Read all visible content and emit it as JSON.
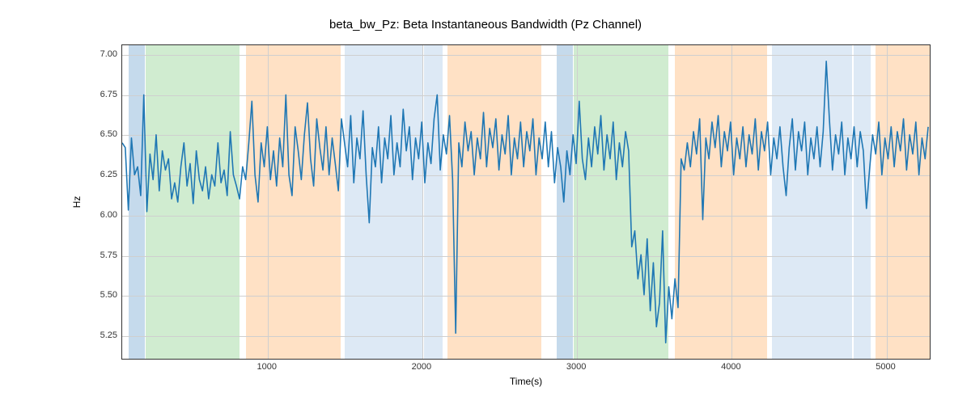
{
  "chart_data": {
    "type": "line",
    "title": "beta_bw_Pz: Beta Instantaneous Bandwidth (Pz Channel)",
    "xlabel": "Time(s)",
    "ylabel": "Hz",
    "xlim": [
      60,
      5290
    ],
    "ylim": [
      5.1,
      7.06
    ],
    "xticks": [
      1000,
      2000,
      3000,
      4000,
      5000
    ],
    "yticks": [
      5.25,
      5.5,
      5.75,
      6.0,
      6.25,
      6.5,
      6.75,
      7.0
    ],
    "background_bands": [
      {
        "start": 100,
        "end": 205,
        "color": "rgba(90,150,200,0.35)"
      },
      {
        "start": 210,
        "end": 820,
        "color": "rgba(120,200,120,0.35)"
      },
      {
        "start": 860,
        "end": 1470,
        "color": "rgba(255,180,110,0.40)"
      },
      {
        "start": 1500,
        "end": 2000,
        "color": "rgba(170,200,230,0.40)"
      },
      {
        "start": 2010,
        "end": 2130,
        "color": "rgba(170,200,230,0.40)"
      },
      {
        "start": 2160,
        "end": 2770,
        "color": "rgba(255,180,110,0.40)"
      },
      {
        "start": 2870,
        "end": 2975,
        "color": "rgba(90,150,200,0.35)"
      },
      {
        "start": 2980,
        "end": 3590,
        "color": "rgba(120,200,120,0.35)"
      },
      {
        "start": 3630,
        "end": 4230,
        "color": "rgba(255,180,110,0.40)"
      },
      {
        "start": 4260,
        "end": 4780,
        "color": "rgba(170,200,230,0.40)"
      },
      {
        "start": 4790,
        "end": 4900,
        "color": "rgba(170,200,230,0.40)"
      },
      {
        "start": 4930,
        "end": 5290,
        "color": "rgba(255,180,110,0.40)"
      }
    ],
    "series": [
      {
        "name": "beta_bw_Pz",
        "color": "#1f77b4",
        "x_start": 60,
        "x_step": 20,
        "values": [
          6.45,
          6.42,
          6.03,
          6.48,
          6.25,
          6.3,
          6.12,
          6.75,
          6.02,
          6.38,
          6.22,
          6.5,
          6.15,
          6.4,
          6.28,
          6.35,
          6.1,
          6.2,
          6.08,
          6.3,
          6.45,
          6.18,
          6.32,
          6.07,
          6.4,
          6.22,
          6.15,
          6.3,
          6.1,
          6.25,
          6.18,
          6.45,
          6.2,
          6.28,
          6.12,
          6.52,
          6.25,
          6.18,
          6.1,
          6.3,
          6.22,
          6.45,
          6.71,
          6.25,
          6.08,
          6.45,
          6.3,
          6.55,
          6.22,
          6.4,
          6.18,
          6.48,
          6.3,
          6.75,
          6.25,
          6.12,
          6.55,
          6.4,
          6.22,
          6.5,
          6.7,
          6.35,
          6.18,
          6.6,
          6.42,
          6.28,
          6.55,
          6.25,
          6.48,
          6.32,
          6.15,
          6.6,
          6.45,
          6.3,
          6.62,
          6.2,
          6.48,
          6.35,
          6.65,
          6.25,
          5.95,
          6.42,
          6.3,
          6.55,
          6.2,
          6.48,
          6.35,
          6.62,
          6.25,
          6.45,
          6.3,
          6.66,
          6.4,
          6.55,
          6.22,
          6.48,
          6.35,
          6.58,
          6.2,
          6.45,
          6.32,
          6.6,
          6.75,
          6.28,
          6.5,
          6.38,
          6.62,
          6.22,
          5.26,
          6.45,
          6.3,
          6.58,
          6.4,
          6.52,
          6.25,
          6.48,
          6.35,
          6.64,
          6.3,
          6.54,
          6.42,
          6.6,
          6.28,
          6.5,
          6.38,
          6.62,
          6.25,
          6.48,
          6.35,
          6.58,
          6.3,
          6.52,
          6.4,
          6.6,
          6.25,
          6.48,
          6.35,
          6.58,
          6.3,
          6.52,
          6.2,
          6.42,
          6.3,
          6.08,
          6.4,
          6.25,
          6.5,
          6.32,
          6.71,
          6.35,
          6.22,
          6.48,
          6.3,
          6.55,
          6.38,
          6.62,
          6.28,
          6.5,
          6.35,
          6.58,
          6.22,
          6.45,
          6.3,
          6.52,
          6.4,
          5.8,
          5.9,
          5.6,
          5.75,
          5.5,
          5.85,
          5.4,
          5.7,
          5.3,
          5.45,
          5.9,
          5.2,
          5.55,
          5.35,
          5.6,
          5.42,
          6.35,
          6.28,
          6.45,
          6.3,
          6.52,
          6.38,
          6.6,
          5.97,
          6.48,
          6.35,
          6.58,
          6.42,
          6.62,
          6.3,
          6.52,
          6.4,
          6.58,
          6.25,
          6.48,
          6.35,
          6.55,
          6.3,
          6.5,
          6.38,
          6.6,
          6.28,
          6.52,
          6.4,
          6.58,
          6.25,
          6.48,
          6.35,
          6.55,
          6.3,
          6.12,
          6.42,
          6.6,
          6.28,
          6.52,
          6.4,
          6.58,
          6.25,
          6.48,
          6.35,
          6.55,
          6.3,
          6.52,
          6.96,
          6.6,
          6.28,
          6.5,
          6.38,
          6.58,
          6.25,
          6.48,
          6.35,
          6.55,
          6.3,
          6.52,
          6.4,
          6.04,
          6.28,
          6.5,
          6.38,
          6.58,
          6.25,
          6.48,
          6.35,
          6.55,
          6.3,
          6.52,
          6.4,
          6.6,
          6.28,
          6.5,
          6.38,
          6.58,
          6.25,
          6.48,
          6.35,
          6.55
        ]
      }
    ]
  }
}
